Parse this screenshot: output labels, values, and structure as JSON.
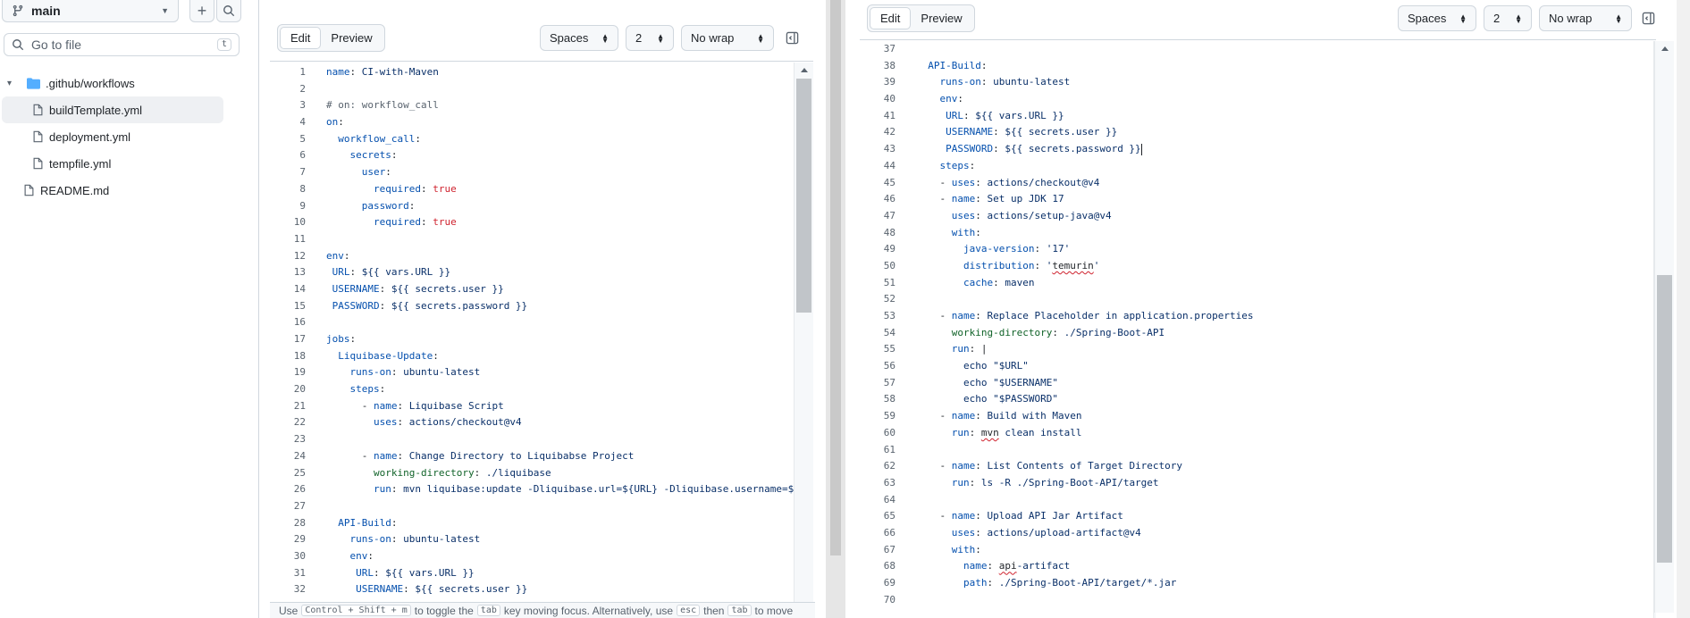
{
  "sidebar": {
    "branch": "main",
    "goto_placeholder": "Go to file",
    "goto_shortcut": "t",
    "tree": [
      {
        "type": "folder",
        "label": ".github/workflows",
        "expanded": true,
        "active": false
      },
      {
        "type": "file",
        "label": "buildTemplate.yml",
        "active": true
      },
      {
        "type": "file",
        "label": "deployment.yml",
        "active": false
      },
      {
        "type": "file",
        "label": "tempfile.yml",
        "active": false
      },
      {
        "type": "file",
        "label": "README.md",
        "active": false
      }
    ]
  },
  "left_editor": {
    "tab_edit": "Edit",
    "tab_preview": "Preview",
    "indent_mode": "Spaces",
    "indent_size": "2",
    "wrap_mode": "No wrap",
    "lines": [
      [
        [
          "k2",
          "name"
        ],
        [
          "",
          "",
          ": "
        ],
        [
          "v",
          "CI-with-Maven"
        ]
      ],
      [],
      [
        [
          "c",
          "# on: workflow_call"
        ]
      ],
      [
        [
          "k2",
          "on"
        ],
        [
          "",
          ":"
        ]
      ],
      [
        [
          "",
          "  "
        ],
        [
          "k2",
          "workflow_call"
        ],
        [
          "",
          ":"
        ]
      ],
      [
        [
          "",
          "    "
        ],
        [
          "k2",
          "secrets"
        ],
        [
          "",
          ":"
        ]
      ],
      [
        [
          "",
          "      "
        ],
        [
          "k2",
          "user"
        ],
        [
          "",
          ":"
        ]
      ],
      [
        [
          "",
          "        "
        ],
        [
          "k2",
          "required"
        ],
        [
          "",
          ": "
        ],
        [
          "b",
          "true"
        ]
      ],
      [
        [
          "",
          "      "
        ],
        [
          "k2",
          "password"
        ],
        [
          "",
          ":"
        ]
      ],
      [
        [
          "",
          "        "
        ],
        [
          "k2",
          "required"
        ],
        [
          "",
          ": "
        ],
        [
          "b",
          "true"
        ]
      ],
      [],
      [
        [
          "k2",
          "env"
        ],
        [
          "",
          ":"
        ]
      ],
      [
        [
          "",
          "",
          " "
        ],
        [
          "k2",
          "URL"
        ],
        [
          "",
          ": "
        ],
        [
          "v",
          "${{ vars.URL }}"
        ]
      ],
      [
        [
          "",
          "",
          " "
        ],
        [
          "k2",
          "USERNAME"
        ],
        [
          "",
          ": "
        ],
        [
          "v",
          "${{ secrets.user }}"
        ]
      ],
      [
        [
          "",
          "",
          " "
        ],
        [
          "k2",
          "PASSWORD"
        ],
        [
          "",
          ": "
        ],
        [
          "v",
          "${{ secrets.password }}"
        ]
      ],
      [],
      [
        [
          "k2",
          "jobs"
        ],
        [
          "",
          ":"
        ]
      ],
      [
        [
          "",
          "  "
        ],
        [
          "k2",
          "Liquibase-Update"
        ],
        [
          "",
          ":"
        ]
      ],
      [
        [
          "",
          "    "
        ],
        [
          "k2",
          "runs-on"
        ],
        [
          "",
          ": "
        ],
        [
          "v",
          "ubuntu-latest"
        ]
      ],
      [
        [
          "",
          "    "
        ],
        [
          "k2",
          "steps"
        ],
        [
          "",
          ":"
        ]
      ],
      [
        [
          "",
          "      - "
        ],
        [
          "k2",
          "name"
        ],
        [
          "",
          ": "
        ],
        [
          "v",
          "Liquibase Script"
        ]
      ],
      [
        [
          "",
          "        "
        ],
        [
          "k2",
          "uses"
        ],
        [
          "",
          ": "
        ],
        [
          "v",
          "actions/checkout@v4"
        ]
      ],
      [],
      [
        [
          "",
          "      - "
        ],
        [
          "k2",
          "name"
        ],
        [
          "",
          ": "
        ],
        [
          "v",
          "Change Directory to Liquibabse Project"
        ]
      ],
      [
        [
          "",
          "        "
        ],
        [
          "k",
          "working-directory"
        ],
        [
          "",
          ": "
        ],
        [
          "v",
          "./liquibase"
        ]
      ],
      [
        [
          "",
          "        "
        ],
        [
          "k2",
          "run"
        ],
        [
          "",
          ": "
        ],
        [
          "v",
          "mvn liquibase:update -Dliquibase.url=${URL} -Dliquibase.username=${{ sec"
        ]
      ],
      [],
      [
        [
          "",
          "  "
        ],
        [
          "k2",
          "API-Build"
        ],
        [
          "",
          ":"
        ]
      ],
      [
        [
          "",
          "    "
        ],
        [
          "k2",
          "runs-on"
        ],
        [
          "",
          ": "
        ],
        [
          "v",
          "ubuntu-latest"
        ]
      ],
      [
        [
          "",
          "    "
        ],
        [
          "k2",
          "env"
        ],
        [
          "",
          ":"
        ]
      ],
      [
        [
          "",
          "     "
        ],
        [
          "k2",
          "URL"
        ],
        [
          "",
          ": "
        ],
        [
          "v",
          "${{ vars.URL }}"
        ]
      ],
      [
        [
          "",
          "     "
        ],
        [
          "k2",
          "USERNAME"
        ],
        [
          "",
          ": "
        ],
        [
          "v",
          "${{ secrets.user }}"
        ]
      ]
    ]
  },
  "right_editor": {
    "tab_edit": "Edit",
    "tab_preview": "Preview",
    "indent_mode": "Spaces",
    "indent_size": "2",
    "wrap_mode": "No wrap",
    "first_line": 37,
    "lines": [
      [],
      [
        [
          "",
          "  "
        ],
        [
          "k2",
          "API-Build"
        ],
        [
          "",
          ":"
        ]
      ],
      [
        [
          "",
          "    "
        ],
        [
          "k2",
          "runs-on"
        ],
        [
          "",
          ": "
        ],
        [
          "v",
          "ubuntu-latest"
        ]
      ],
      [
        [
          "",
          "    "
        ],
        [
          "k2",
          "env"
        ],
        [
          "",
          ":"
        ]
      ],
      [
        [
          "",
          "     "
        ],
        [
          "k2",
          "URL"
        ],
        [
          "",
          ": "
        ],
        [
          "v",
          "${{ vars.URL }}"
        ]
      ],
      [
        [
          "",
          "     "
        ],
        [
          "k2",
          "USERNAME"
        ],
        [
          "",
          ": "
        ],
        [
          "v",
          "${{ secrets.user }}"
        ]
      ],
      [
        [
          "",
          "     "
        ],
        [
          "k2",
          "PASSWORD"
        ],
        [
          "",
          ": "
        ],
        [
          "v",
          "${{ secrets.password }}"
        ],
        [
          "caret",
          ""
        ]
      ],
      [
        [
          "",
          "    "
        ],
        [
          "k2",
          "steps"
        ],
        [
          "",
          ":"
        ]
      ],
      [
        [
          "",
          "    - "
        ],
        [
          "k2",
          "uses"
        ],
        [
          "",
          ": "
        ],
        [
          "v",
          "actions/checkout@v4"
        ]
      ],
      [
        [
          "",
          "    - "
        ],
        [
          "k2",
          "name"
        ],
        [
          "",
          ": "
        ],
        [
          "v",
          "Set up JDK 17"
        ]
      ],
      [
        [
          "",
          "      "
        ],
        [
          "k2",
          "uses"
        ],
        [
          "",
          ": "
        ],
        [
          "v",
          "actions/setup-java@v4"
        ]
      ],
      [
        [
          "",
          "      "
        ],
        [
          "k2",
          "with"
        ],
        [
          "",
          ":"
        ]
      ],
      [
        [
          "",
          "        "
        ],
        [
          "k2",
          "java-version"
        ],
        [
          "",
          ": "
        ],
        [
          "v",
          "'17'"
        ]
      ],
      [
        [
          "",
          "        "
        ],
        [
          "k2",
          "distribution"
        ],
        [
          "",
          ": "
        ],
        [
          "v",
          "'"
        ],
        [
          "sq",
          "temurin"
        ],
        [
          "v",
          "'"
        ]
      ],
      [
        [
          "",
          "        "
        ],
        [
          "k2",
          "cache"
        ],
        [
          "",
          ": "
        ],
        [
          "v",
          "maven"
        ]
      ],
      [],
      [
        [
          "",
          "    - "
        ],
        [
          "k2",
          "name"
        ],
        [
          "",
          ": "
        ],
        [
          "v",
          "Replace Placeholder in application.properties"
        ]
      ],
      [
        [
          "",
          "      "
        ],
        [
          "k",
          "working-directory"
        ],
        [
          "",
          ": "
        ],
        [
          "v",
          "./Spring-Boot-API"
        ]
      ],
      [
        [
          "",
          "      "
        ],
        [
          "k2",
          "run"
        ],
        [
          "",
          ": "
        ],
        [
          "",
          "|"
        ]
      ],
      [
        [
          "",
          "        "
        ],
        [
          "v",
          "echo \"$URL\""
        ]
      ],
      [
        [
          "",
          "        "
        ],
        [
          "v",
          "echo \"$USERNAME\""
        ]
      ],
      [
        [
          "",
          "        "
        ],
        [
          "v",
          "echo \"$PASSWORD\""
        ]
      ],
      [
        [
          "",
          "    - "
        ],
        [
          "k2",
          "name"
        ],
        [
          "",
          ": "
        ],
        [
          "v",
          "Build with Maven"
        ]
      ],
      [
        [
          "",
          "      "
        ],
        [
          "k2",
          "run"
        ],
        [
          "",
          ": "
        ],
        [
          "sq",
          "mvn"
        ],
        [
          "v",
          " clean install"
        ]
      ],
      [],
      [
        [
          "",
          "    - "
        ],
        [
          "k2",
          "name"
        ],
        [
          "",
          ": "
        ],
        [
          "v",
          "List Contents of Target Directory"
        ]
      ],
      [
        [
          "",
          "      "
        ],
        [
          "k2",
          "run"
        ],
        [
          "",
          ": "
        ],
        [
          "v",
          "ls -R ./Spring-Boot-API/target"
        ]
      ],
      [],
      [
        [
          "",
          "    - "
        ],
        [
          "k2",
          "name"
        ],
        [
          "",
          ": "
        ],
        [
          "v",
          "Upload API Jar Artifact"
        ]
      ],
      [
        [
          "",
          "      "
        ],
        [
          "k2",
          "uses"
        ],
        [
          "",
          ": "
        ],
        [
          "v",
          "actions/upload-artifact@v4"
        ]
      ],
      [
        [
          "",
          "      "
        ],
        [
          "k2",
          "with"
        ],
        [
          "",
          ":"
        ]
      ],
      [
        [
          "",
          "        "
        ],
        [
          "k2",
          "name"
        ],
        [
          "",
          ": "
        ],
        [
          "sq",
          "api"
        ],
        [
          "v",
          "-artifact"
        ]
      ],
      [
        [
          "",
          "        "
        ],
        [
          "k2",
          "path"
        ],
        [
          "",
          ": "
        ],
        [
          "v",
          "./Spring-Boot-API/target/*.jar"
        ]
      ],
      []
    ]
  },
  "help_bar": {
    "p1": "Use",
    "k1": "Control + Shift + m",
    "p2": "to toggle the",
    "k2": "tab",
    "p3": "key moving focus. Alternatively, use",
    "k3": "esc",
    "p4": "then",
    "k4": "tab",
    "p5": "to move"
  }
}
